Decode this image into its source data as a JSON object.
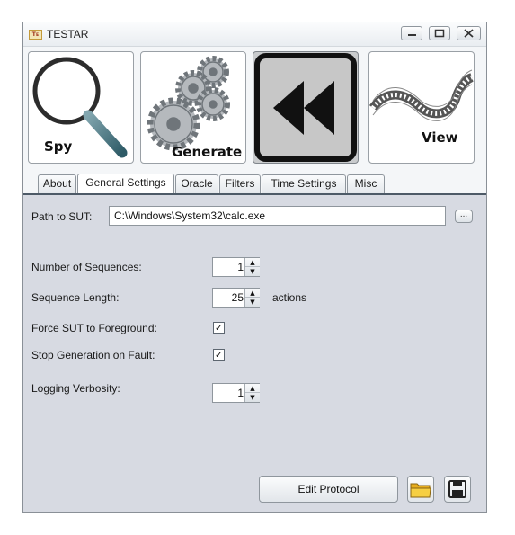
{
  "window": {
    "title": "TESTAR",
    "app_icon_text": "Tᴇ"
  },
  "toolbar": {
    "spy_label": "Spy",
    "generate_label": "Generate",
    "view_label": "View"
  },
  "tabs": [
    {
      "label": "About",
      "active": false
    },
    {
      "label": "General Settings",
      "active": true
    },
    {
      "label": "Oracle",
      "active": false
    },
    {
      "label": "Filters",
      "active": false
    },
    {
      "label": "Time Settings",
      "active": false
    },
    {
      "label": "Misc",
      "active": false
    }
  ],
  "settings": {
    "path_label": "Path to SUT:",
    "path_value": "C:\\Windows\\System32\\calc.exe",
    "browse_label": "...",
    "num_sequences_label": "Number of Sequences:",
    "num_sequences_value": "1",
    "sequence_length_label": "Sequence Length:",
    "sequence_length_value": "25",
    "sequence_length_unit": "actions",
    "force_foreground_label": "Force SUT to Foreground:",
    "force_foreground_checked": true,
    "stop_on_fault_label": "Stop Generation on Fault:",
    "stop_on_fault_checked": true,
    "logging_label": "Logging Verbosity:",
    "logging_value": "1",
    "check_glyph": "✓"
  },
  "footer": {
    "edit_protocol_label": "Edit Protocol",
    "open_icon": "folder-icon",
    "save_icon": "save-icon"
  },
  "colors": {
    "panel_bg": "#d7dae2",
    "tab_line": "#4d5a67",
    "folder_yellow": "#f2c230"
  }
}
